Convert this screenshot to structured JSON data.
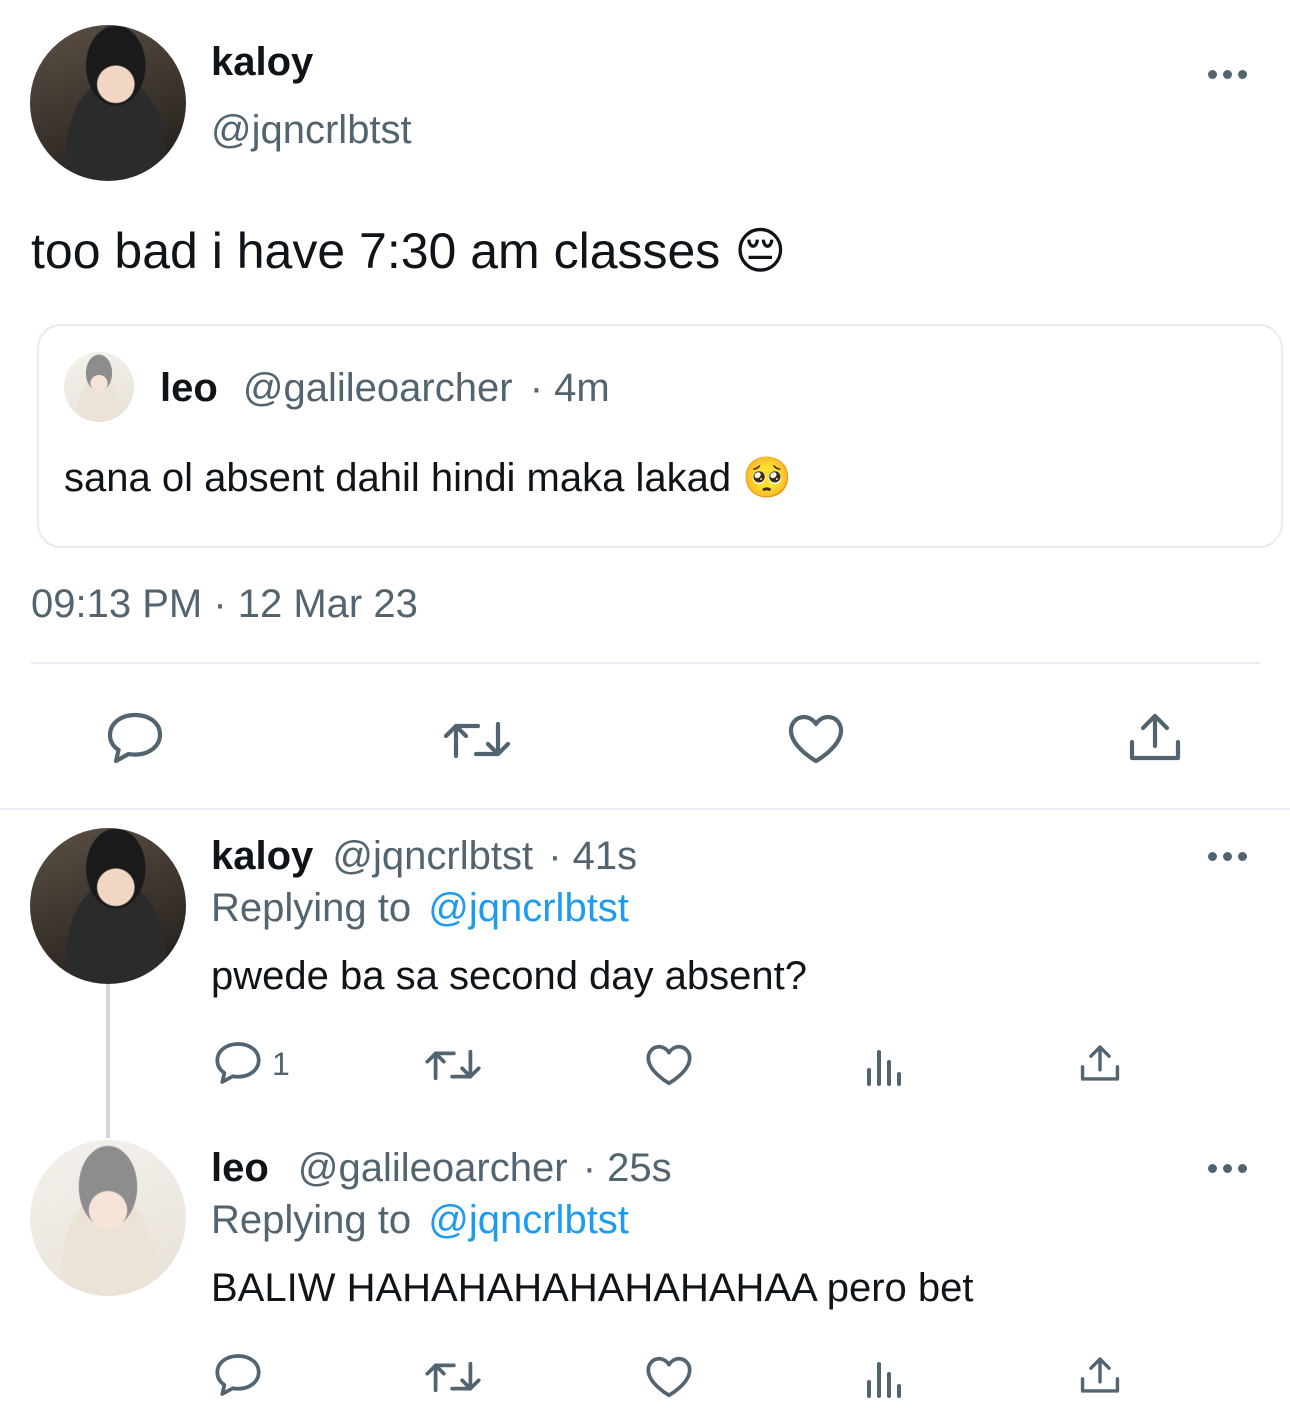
{
  "main_tweet": {
    "display_name": "kaloy",
    "handle": "@jqncrlbtst",
    "text": "too bad i have 7:30 am classes 😔",
    "timestamp": "09:13 PM · 12 Mar 23",
    "quote": {
      "display_name": "leo",
      "handle": "@galileoarcher",
      "time": "· 4m",
      "text": "sana ol absent dahil hindi maka lakad 🥺"
    }
  },
  "replies": [
    {
      "display_name": "kaloy",
      "handle": "@jqncrlbtst",
      "time": "· 41s",
      "replying_prefix": "Replying to",
      "replying_to": "@jqncrlbtst",
      "text": "pwede ba sa second day absent?",
      "reply_count": "1"
    },
    {
      "display_name": "leo",
      "handle": "@galileoarcher",
      "time": "· 25s",
      "replying_prefix": "Replying to",
      "replying_to": "@jqncrlbtst",
      "text": "BALIW HAHAHAHAHAHAHAHAA pero bet",
      "reply_count": ""
    }
  ],
  "colors": {
    "text": "#0f1419",
    "muted": "#536471",
    "link": "#1d9bf0",
    "border": "#e6ecf0"
  },
  "icons": [
    "more-icon",
    "reply-icon",
    "retweet-icon",
    "like-icon",
    "share-icon",
    "views-icon"
  ]
}
